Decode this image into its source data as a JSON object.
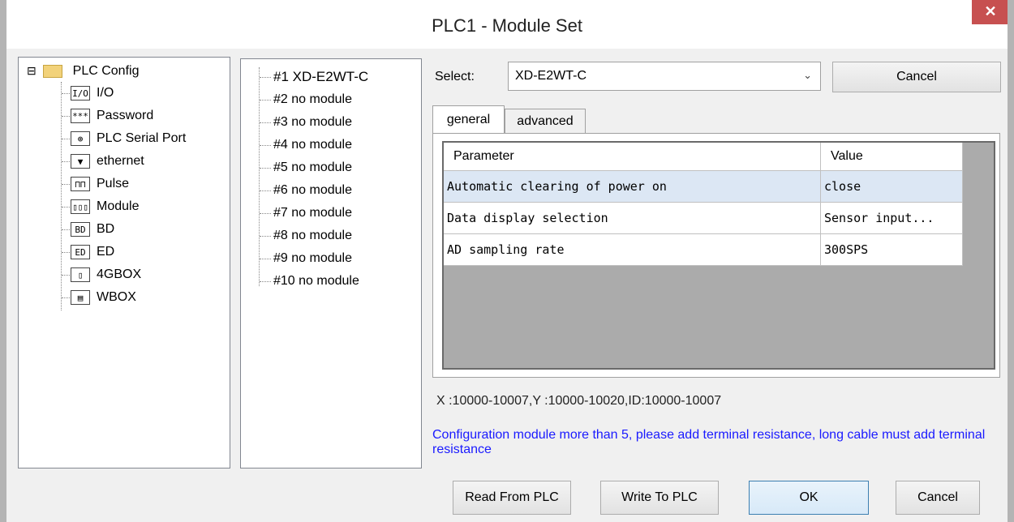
{
  "window": {
    "title": "PLC1 - Module  Set",
    "close_glyph": "✕"
  },
  "tree": {
    "root": {
      "label": "PLC Config",
      "expander": "⊟",
      "icon": "folder-icon"
    },
    "items": [
      {
        "label": "I/O",
        "icon_text": "I/O",
        "icon": "io-icon"
      },
      {
        "label": "Password",
        "icon_text": "***",
        "icon": "password-icon"
      },
      {
        "label": "PLC Serial Port",
        "icon_text": "⊕",
        "icon": "serial-port-icon"
      },
      {
        "label": "ethernet",
        "icon_text": "▼",
        "icon": "ethernet-icon"
      },
      {
        "label": "Pulse",
        "icon_text": "⊓⊓",
        "icon": "pulse-icon"
      },
      {
        "label": "Module",
        "icon_text": "▯▯▯",
        "icon": "module-icon"
      },
      {
        "label": "BD",
        "icon_text": "BD",
        "icon": "bd-icon"
      },
      {
        "label": "ED",
        "icon_text": "ED",
        "icon": "ed-icon"
      },
      {
        "label": "4GBOX",
        "icon_text": "▯",
        "icon": "4gbox-icon"
      },
      {
        "label": "WBOX",
        "icon_text": "▤",
        "icon": "wbox-icon"
      }
    ]
  },
  "modules": [
    "#1 XD-E2WT-C",
    "#2 no module",
    "#3 no module",
    "#4 no module",
    "#5 no module",
    "#6 no module",
    "#7 no module",
    "#8 no module",
    "#9 no module",
    "#10 no module"
  ],
  "select": {
    "label": "Select:",
    "value": "XD-E2WT-C",
    "arrow": "⌄",
    "cancel": "Cancel"
  },
  "tabs": {
    "general": "general",
    "advanced": "advanced"
  },
  "params": {
    "headers": {
      "parameter": "Parameter",
      "value": "Value"
    },
    "rows": [
      {
        "parameter": "Automatic clearing of power on",
        "value": "close"
      },
      {
        "parameter": "Data display selection",
        "value": "Sensor input..."
      },
      {
        "parameter": "AD sampling rate",
        "value": "300SPS"
      }
    ]
  },
  "address_info": "X :10000-10007,Y :10000-10020,ID:10000-10007",
  "warning": "Configuration module more than 5, please add terminal resistance, long cable must add terminal resistance",
  "buttons": {
    "read": "Read From PLC",
    "write": "Write To PLC",
    "ok": "OK",
    "cancel": "Cancel"
  },
  "colors": {
    "warning_text": "#1a1aff",
    "close_button": "#c75050",
    "row_highlight": "#dce7f4"
  }
}
